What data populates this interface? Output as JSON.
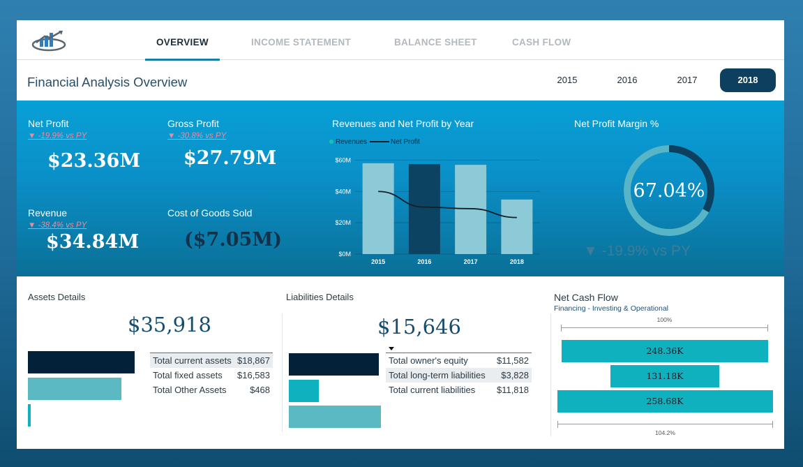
{
  "nav": {
    "tabs": [
      {
        "label": "OVERVIEW"
      },
      {
        "label": "INCOME STATEMENT"
      },
      {
        "label": "BALANCE SHEET"
      },
      {
        "label": "CASH FLOW"
      }
    ],
    "active_tab": "OVERVIEW"
  },
  "header": {
    "title": "Financial Analysis Overview",
    "years": [
      "2015",
      "2016",
      "2017",
      "2018"
    ],
    "selected_year": "2018"
  },
  "kpis": {
    "net_profit": {
      "label": "Net Profit",
      "delta": "-19.9% vs PY",
      "value": "$23.36M"
    },
    "gross_profit": {
      "label": "Gross Profit",
      "delta": "-30.8% vs PY",
      "value": "$27.79M"
    },
    "revenue": {
      "label": "Revenue",
      "delta": "-38.4% vs PY",
      "value": "$34.84M"
    },
    "cogs": {
      "label": "Cost of Goods Sold",
      "value": "($7.05M)"
    }
  },
  "chart": {
    "title": "Revenues and Net Profit by Year",
    "legend": [
      "Revenues",
      "Net Profit"
    ]
  },
  "chart_data": {
    "type": "bar",
    "categories": [
      "2015",
      "2016",
      "2017",
      "2018"
    ],
    "series": [
      {
        "name": "Revenues",
        "type": "bar",
        "values": [
          58,
          57.5,
          57,
          34.84
        ]
      },
      {
        "name": "Net Profit",
        "type": "line",
        "values": [
          40,
          30,
          29,
          23.36
        ]
      }
    ],
    "y_ticks": [
      "$0M",
      "$20M",
      "$40M",
      "$60M"
    ],
    "ylim": [
      0,
      60
    ],
    "highlight_category": "2016",
    "colors": {
      "bar": "#8ccad8",
      "bar_highlight": "#0c4363",
      "line": "#13202a"
    }
  },
  "margin": {
    "title": "Net Profit Margin %",
    "value": "67.04%",
    "fraction": 0.6704,
    "delta": "▼ -19.9% vs PY"
  },
  "assets": {
    "title": "Assets Details",
    "total": "$35,918",
    "rows": [
      {
        "label": "Total current assets",
        "value": "$18,867",
        "amount": 18867
      },
      {
        "label": "Total fixed assets",
        "value": "$16,583",
        "amount": 16583
      },
      {
        "label": "Total Other Assets",
        "value": "$468",
        "amount": 468
      }
    ]
  },
  "liabilities": {
    "title": "Liabilities Details",
    "total": "$15,646",
    "rows": [
      {
        "label": "Total owner's equity",
        "value": "$11,582",
        "amount": 11582
      },
      {
        "label": "Total long-term liabilities",
        "value": "$3,828",
        "amount": 3828
      },
      {
        "label": "Total current liabilities",
        "value": "$11,818",
        "amount": 11818
      }
    ]
  },
  "cash_flow": {
    "title": "Net Cash Flow",
    "subtitle": "Financing - Investing & Operational",
    "top_pct": "100%",
    "bottom_pct": "104.2%",
    "bars": [
      {
        "label": "248.36K",
        "value": 248.36
      },
      {
        "label": "131.18K",
        "value": 131.18
      },
      {
        "label": "258.68K",
        "value": 258.68
      }
    ]
  },
  "colors": {
    "accent": "#1a7fa3",
    "band": "#0a8fc7",
    "asset_bar_1": "#04213a",
    "asset_bar_2": "#5bb9c4",
    "liab_bar_1": "#04213a",
    "liab_bar_2": "#10b1bf",
    "liab_bar_3": "#5bb9c4",
    "donut_track": "#0d3f5e",
    "donut_fill": "#57b5c8"
  }
}
